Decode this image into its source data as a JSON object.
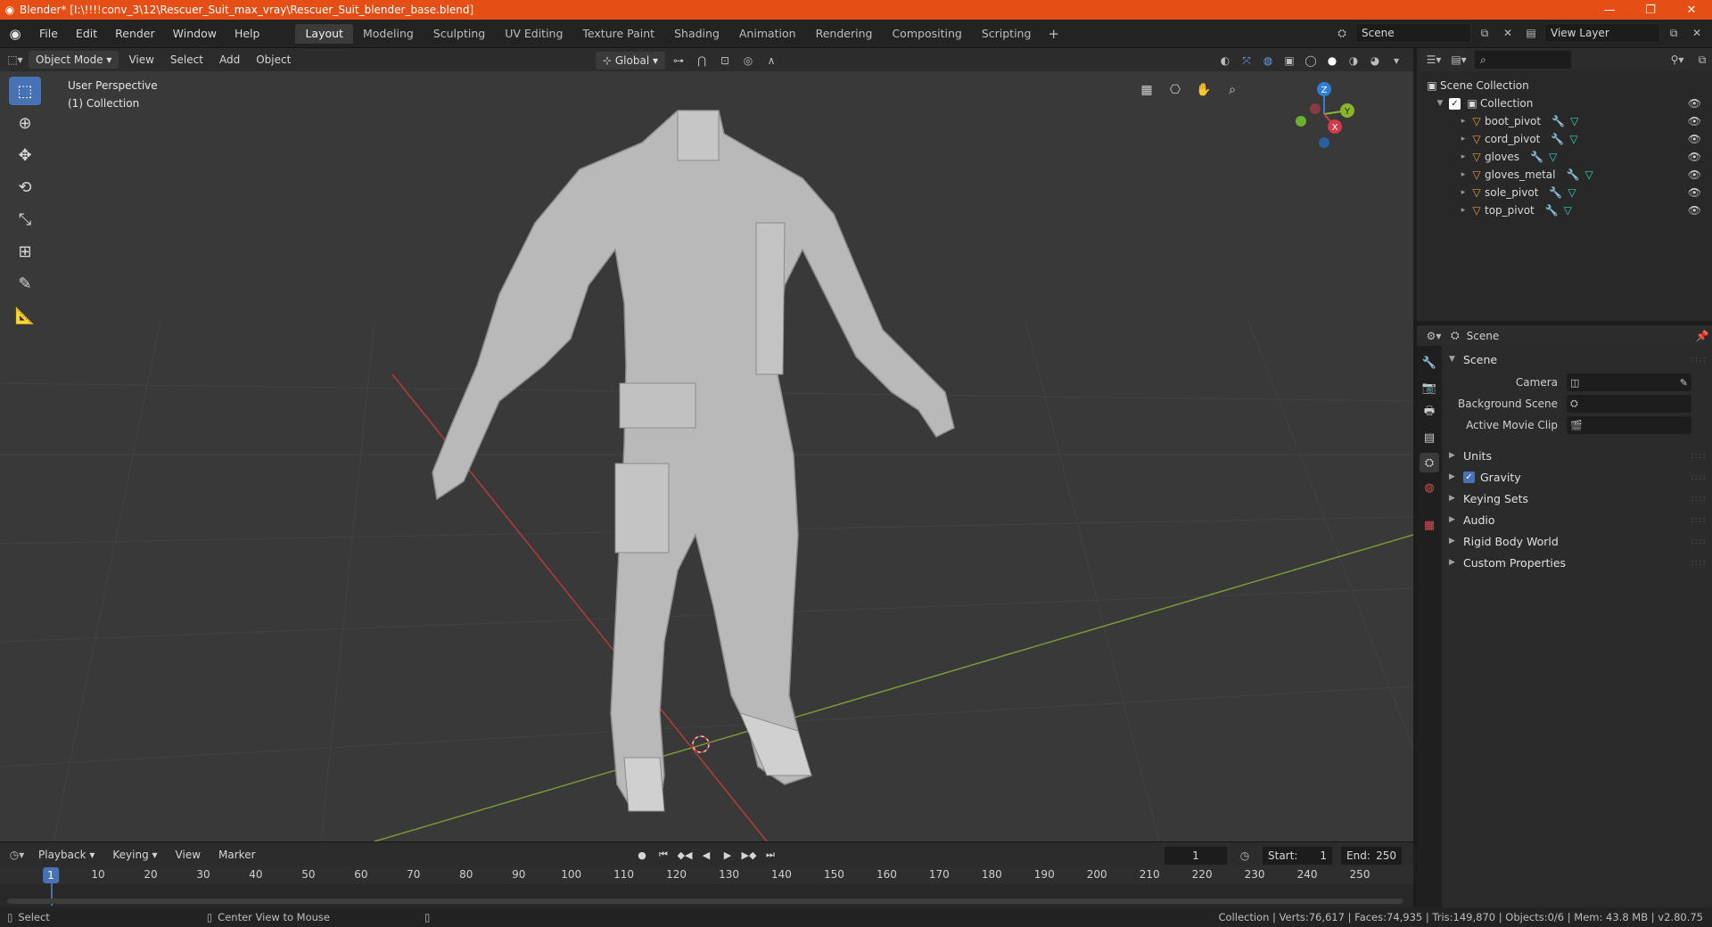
{
  "window": {
    "title": "Blender* [I:\\!!!!conv_3\\12\\Rescuer_Suit_max_vray\\Rescuer_Suit_blender_base.blend]",
    "minimize": "—",
    "maximize": "❐",
    "close": "✕"
  },
  "menu": [
    "File",
    "Edit",
    "Render",
    "Window",
    "Help"
  ],
  "workspaces": [
    "Layout",
    "Modeling",
    "Sculpting",
    "UV Editing",
    "Texture Paint",
    "Shading",
    "Animation",
    "Rendering",
    "Compositing",
    "Scripting"
  ],
  "active_workspace": "Layout",
  "scene_name": "Scene",
  "view_layer": "View Layer",
  "viewport": {
    "mode": "Object Mode",
    "menus": [
      "View",
      "Select",
      "Add",
      "Object"
    ],
    "transform_orientation": "Global",
    "info_line1": "User Perspective",
    "info_line2": "(1) Collection",
    "gizmo_axes": {
      "x": "X",
      "y": "Y",
      "z": "Z"
    }
  },
  "timeline": {
    "menus": [
      "Playback",
      "Keying",
      "View",
      "Marker"
    ],
    "current_frame": "1",
    "start_label": "Start:",
    "start": "1",
    "end_label": "End:",
    "end": "250",
    "ticks": [
      "10",
      "20",
      "30",
      "40",
      "50",
      "60",
      "70",
      "80",
      "90",
      "100",
      "110",
      "120",
      "130",
      "140",
      "150",
      "160",
      "170",
      "180",
      "190",
      "200",
      "210",
      "220",
      "230",
      "240",
      "250"
    ]
  },
  "status": {
    "select": "Select",
    "center_view": "Center View to Mouse",
    "stats": "Collection | Verts:76,617 | Faces:74,935 | Tris:149,870 | Objects:0/6 | Mem: 43.8 MB | v2.80.75"
  },
  "outliner": {
    "root": "Scene Collection",
    "collection": "Collection",
    "objects": [
      "boot_pivot",
      "cord_pivot",
      "gloves",
      "gloves_metal",
      "sole_pivot",
      "top_pivot"
    ]
  },
  "properties": {
    "context": "Scene",
    "panel": "Scene",
    "rows": [
      {
        "label": "Camera"
      },
      {
        "label": "Background Scene"
      },
      {
        "label": "Active Movie Clip"
      }
    ],
    "subpanels": [
      "Units",
      "Gravity",
      "Keying Sets",
      "Audio",
      "Rigid Body World",
      "Custom Properties"
    ]
  }
}
